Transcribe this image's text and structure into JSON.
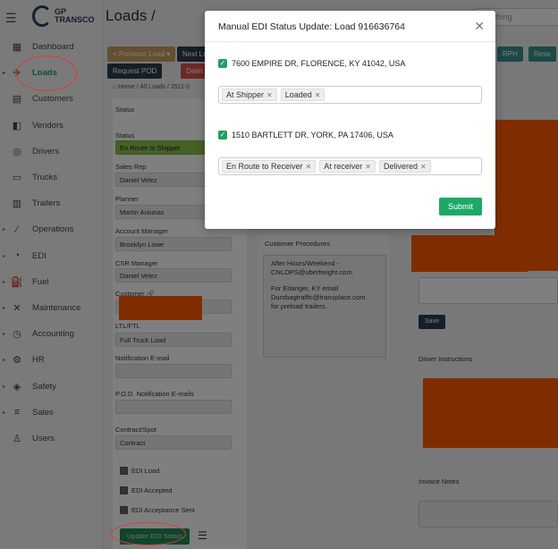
{
  "app": {
    "logo_line1": "GP",
    "logo_line2": "TRANSCO"
  },
  "page": {
    "title": "Loads /",
    "search_placeholder": "thing"
  },
  "sidebar": {
    "items": [
      {
        "label": "Dashboard",
        "icon": "dashboard-icon",
        "glyph": "▦"
      },
      {
        "label": "Loads",
        "icon": "loads-icon",
        "glyph": "✈"
      },
      {
        "label": "Customers",
        "icon": "customers-icon",
        "glyph": "▤"
      },
      {
        "label": "Vendors",
        "icon": "vendors-icon",
        "glyph": "◧"
      },
      {
        "label": "Drivers",
        "icon": "drivers-icon",
        "glyph": "◎"
      },
      {
        "label": "Trucks",
        "icon": "trucks-icon",
        "glyph": "▭"
      },
      {
        "label": "Trailers",
        "icon": "trailers-icon",
        "glyph": "▥"
      },
      {
        "label": "Operations",
        "icon": "operations-icon",
        "glyph": "⁄"
      },
      {
        "label": "EDI",
        "icon": "edi-icon",
        "glyph": "◔"
      },
      {
        "label": "Fuel",
        "icon": "fuel-icon",
        "glyph": "⛽"
      },
      {
        "label": "Maintenance",
        "icon": "maintenance-icon",
        "glyph": "✕"
      },
      {
        "label": "Accounting",
        "icon": "accounting-icon",
        "glyph": "◷"
      },
      {
        "label": "HR",
        "icon": "hr-icon",
        "glyph": "⚙"
      },
      {
        "label": "Safety",
        "icon": "safety-icon",
        "glyph": "◈"
      },
      {
        "label": "Sales",
        "icon": "sales-icon",
        "glyph": "≡"
      },
      {
        "label": "Users",
        "icon": "users-icon",
        "glyph": "♙"
      }
    ]
  },
  "toolbar": {
    "previous_load": "< Previous Load ▾",
    "next_load": "Next Lo",
    "request_pod": "Request POD",
    "delete": "Delet",
    "rph": "RPH",
    "reset": "Rese"
  },
  "breadcrumb": {
    "home": "⌂ Home",
    "all_loads": "All Loads",
    "load_id": "2511-0"
  },
  "form": {
    "status_section": "Status",
    "status_label": "Status",
    "status_value": "En Route to Shipper",
    "sales_rep_label": "Sales Rep",
    "sales_rep_value": "Daniel Velez",
    "planner_label": "Planner",
    "planner_value": "Martin Aniunas",
    "account_manager_label": "Account Manager",
    "account_manager_value": "Brooklyn Lowe",
    "csr_manager_label": "CSR Manager",
    "csr_manager_value": "Daniel Velez",
    "customer_label": "Customer 🔗",
    "ltl_ftl_label": "LTL/FTL",
    "ltl_ftl_value": "Full Truck Load",
    "notification_email_label": "Notification E-mail",
    "pod_email_label": "P.O.D. Notification E-mails",
    "contract_spot_label": "Contract/Spot",
    "contract_spot_value": "Contract",
    "edi_load": "EDI Load",
    "edi_accepted": "EDI Accepted",
    "edi_acceptance_sent": "EDI Acceptance Sent",
    "update_edi_status": "Update EDI Status"
  },
  "customer_procedures": {
    "title": "Customer Procedures",
    "line1": "After Hours/Weekend -",
    "line2": "CNLOPS@uberfreight.com.",
    "line3": "For Erlanger, KY email",
    "line4": "Durobagtraffic@transplace.com",
    "line5": "for preload trailers."
  },
  "right": {
    "save": "Save",
    "driver_instructions": "Driver Instructions",
    "invoice_notes": "Invoice Notes"
  },
  "modal": {
    "title": "Manual EDI Status Update: Load 916636764",
    "close": "✕",
    "stops": [
      {
        "address": "7600 EMPIRE DR, FLORENCE, KY 41042, USA",
        "tags": [
          "At Shipper",
          "Loaded"
        ]
      },
      {
        "address": "1510 BARTLETT DR, YORK, PA 17406, USA",
        "tags": [
          "En Route to Receiver",
          "At receiver",
          "Delivered"
        ]
      }
    ],
    "submit": "Submit"
  }
}
